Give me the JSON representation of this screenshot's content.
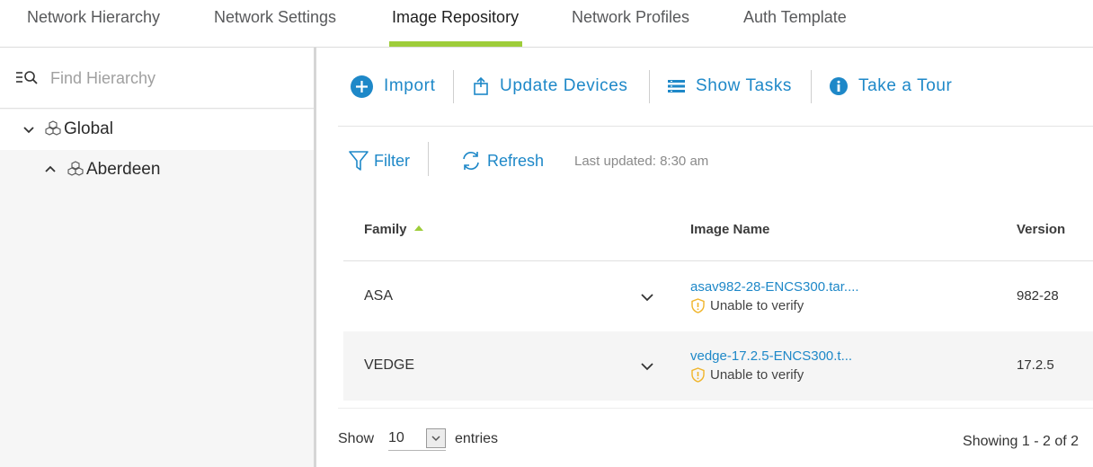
{
  "tabs": [
    {
      "label": "Network Hierarchy"
    },
    {
      "label": "Network Settings"
    },
    {
      "label": "Image Repository",
      "active": true
    },
    {
      "label": "Network Profiles"
    },
    {
      "label": "Auth Template"
    }
  ],
  "sidebar": {
    "search_placeholder": "Find Hierarchy",
    "tree": [
      {
        "label": "Global",
        "expanded": true
      },
      {
        "label": "Aberdeen",
        "expanded": false
      }
    ]
  },
  "toolbar": {
    "import_label": "Import",
    "update_devices_label": "Update Devices",
    "show_tasks_label": "Show Tasks",
    "take_tour_label": "Take a Tour"
  },
  "filterbar": {
    "filter_label": "Filter",
    "refresh_label": "Refresh",
    "last_updated": "Last updated: 8:30 am"
  },
  "table": {
    "columns": [
      "Family",
      "Image Name",
      "Version"
    ],
    "sorted_column": "Family",
    "rows": [
      {
        "family": "ASA",
        "image_name": "asav982-28-ENCS300.tar....",
        "status": "Unable to verify",
        "version": "982-28"
      },
      {
        "family": "VEDGE",
        "image_name": "vedge-17.2.5-ENCS300.t...",
        "status": "Unable to verify",
        "version": "17.2.5"
      }
    ]
  },
  "footer": {
    "show_label": "Show",
    "entries_value": "10",
    "entries_label": "entries",
    "showing": "Showing 1 - 2 of 2"
  },
  "colors": {
    "accent_blue": "#1e88c8",
    "tab_underline_green": "#9ecd3a",
    "warning_yellow": "#f0b429"
  },
  "icons": {
    "search": "search-list-icon",
    "chevron_down": "chevron-down-icon",
    "chevron_up": "chevron-up-icon",
    "site": "site-cubes-icon",
    "import": "plus-circle-icon",
    "update": "upload-icon",
    "tasks": "task-list-icon",
    "tour": "info-circle-icon",
    "filter": "funnel-icon",
    "refresh": "refresh-icon",
    "warning": "warning-shield-icon"
  }
}
